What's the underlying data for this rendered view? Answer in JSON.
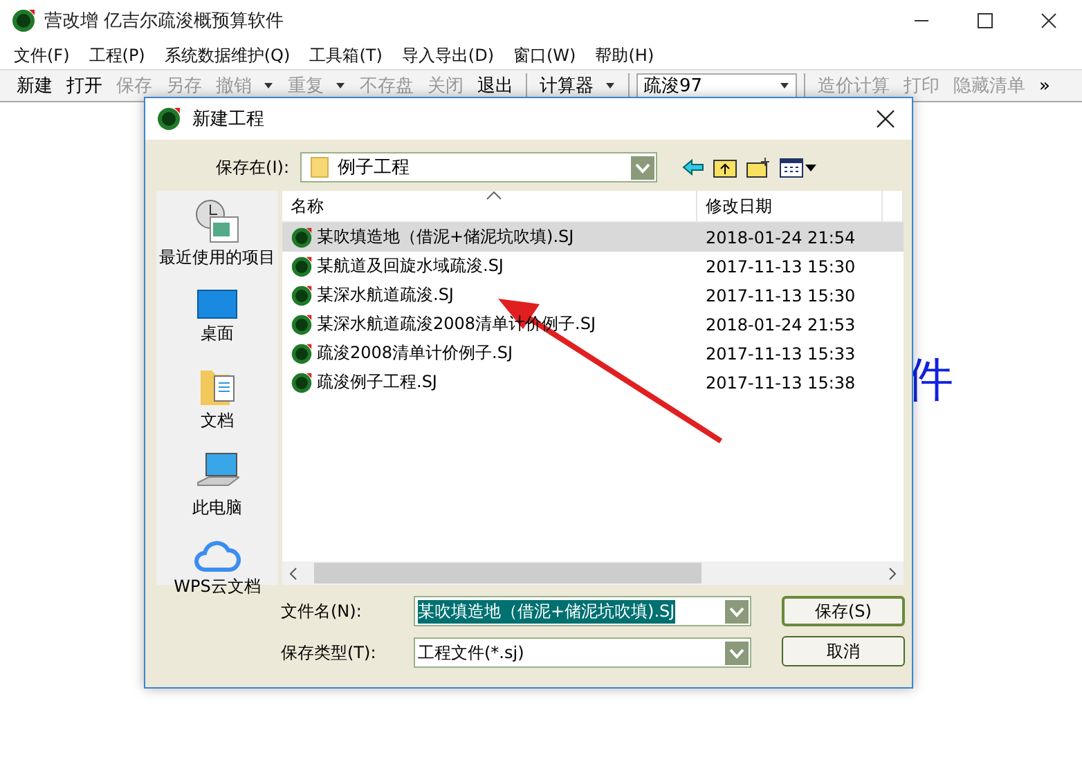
{
  "window": {
    "title": "营改增 亿吉尔疏浚概预算软件"
  },
  "menu": [
    "文件(F)",
    "工程(P)",
    "系统数据维护(Q)",
    "工具箱(T)",
    "导入导出(D)",
    "窗口(W)",
    "帮助(H)"
  ],
  "toolbar": [
    {
      "kind": "button",
      "label": "新建",
      "disabled": false
    },
    {
      "kind": "button",
      "label": "打开",
      "disabled": false
    },
    {
      "kind": "button",
      "label": "保存",
      "disabled": true
    },
    {
      "kind": "button",
      "label": "另存",
      "disabled": true
    },
    {
      "kind": "dropdown",
      "label": "撤销",
      "disabled": true
    },
    {
      "kind": "dropdown",
      "label": "重复",
      "disabled": true
    },
    {
      "kind": "button",
      "label": "不存盘",
      "disabled": true
    },
    {
      "kind": "button",
      "label": "关闭",
      "disabled": true
    },
    {
      "kind": "button",
      "label": "退出",
      "disabled": false
    },
    {
      "kind": "separator"
    },
    {
      "kind": "dropdown",
      "label": "计算器",
      "disabled": false
    },
    {
      "kind": "separator"
    },
    {
      "kind": "combo",
      "label": "疏浚97",
      "disabled": false
    },
    {
      "kind": "separator"
    },
    {
      "kind": "button",
      "label": "造价计算",
      "disabled": true
    },
    {
      "kind": "button",
      "label": "打印",
      "disabled": true
    },
    {
      "kind": "button",
      "label": "隐藏清单",
      "disabled": true
    },
    {
      "kind": "overflow",
      "label": "»",
      "disabled": false
    }
  ],
  "background_text": "件",
  "dialog": {
    "title": "新建工程",
    "save_in_label": "保存在(I):",
    "save_in_value": "例子工程",
    "places": [
      {
        "kind": "recent",
        "label": "最近使用的项目"
      },
      {
        "kind": "desktop",
        "label": "桌面"
      },
      {
        "kind": "documents",
        "label": "文档"
      },
      {
        "kind": "computer",
        "label": "此电脑"
      },
      {
        "kind": "cloud",
        "label": "WPS云文档"
      }
    ],
    "columns": [
      "名称",
      "修改日期"
    ],
    "files": [
      {
        "name": "某吹填造地（借泥+储泥坑吹填).SJ",
        "modified": "2018-01-24 21:54",
        "selected": true
      },
      {
        "name": "某航道及回旋水域疏浚.SJ",
        "modified": "2017-11-13 15:30",
        "selected": false
      },
      {
        "name": "某深水航道疏浚.SJ",
        "modified": "2017-11-13 15:30",
        "selected": false
      },
      {
        "name": "某深水航道疏浚2008清单计价例子.SJ",
        "modified": "2018-01-24 21:53",
        "selected": false
      },
      {
        "name": "疏浚2008清单计价例子.SJ",
        "modified": "2017-11-13 15:33",
        "selected": false
      },
      {
        "name": "疏浚例子工程.SJ",
        "modified": "2017-11-13 15:38",
        "selected": false
      }
    ],
    "filename_label": "文件名(N):",
    "filename_value": "某吹填造地（借泥+储泥坑吹填).SJ",
    "filetype_label": "保存类型(T):",
    "filetype_value": "工程文件(*.sj)",
    "buttons": [
      "保存(S)",
      "取消"
    ]
  }
}
